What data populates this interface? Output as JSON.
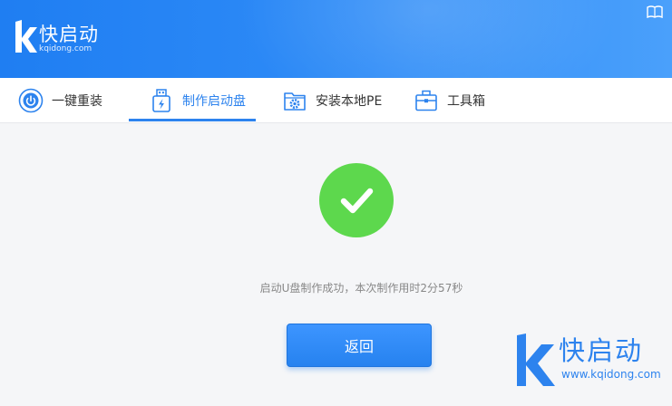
{
  "header": {
    "brand_name": "快启动",
    "brand_url": "kqidong.com",
    "icons": {
      "logo": "k-logo-icon",
      "manual": "book-icon"
    }
  },
  "tabs": [
    {
      "label": "一键重装",
      "icon": "power-icon",
      "active": false
    },
    {
      "label": "制作启动盘",
      "icon": "usb-drive-icon",
      "active": true
    },
    {
      "label": "安装本地PE",
      "icon": "folder-gear-icon",
      "active": false
    },
    {
      "label": "工具箱",
      "icon": "toolbox-icon",
      "active": false
    }
  ],
  "main": {
    "status_icon": "checkmark-icon",
    "message": "启动U盘制作成功，本次制作用时2分57秒",
    "return_label": "返回"
  },
  "watermark": {
    "brand_name": "快启动",
    "brand_url": "www.kqidong.com"
  },
  "colors": {
    "header": "#2f8cf7",
    "accent": "#2d83ee",
    "success": "#5dd84d",
    "button": "#2682ef"
  }
}
